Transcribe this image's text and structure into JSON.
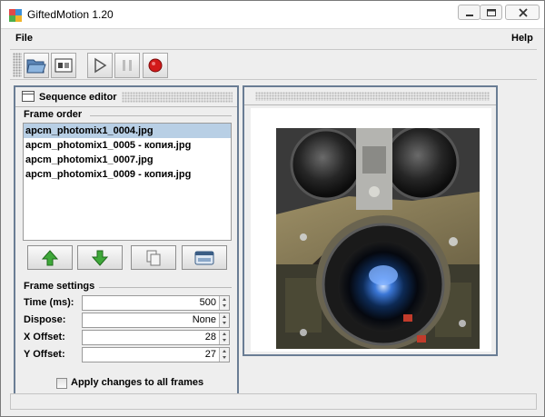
{
  "window": {
    "title": "GiftedMotion 1.20"
  },
  "menu": {
    "file": "File",
    "help": "Help"
  },
  "toolbar": {
    "buttons": [
      "open-icon",
      "frame-settings-icon",
      "play-icon",
      "pause-icon",
      "record-icon"
    ]
  },
  "sequence_editor": {
    "title": "Sequence editor",
    "frame_order_label": "Frame order",
    "frames": [
      "apcm_photomix1_0004.jpg",
      "apcm_photomix1_0005 - копия.jpg",
      "apcm_photomix1_0007.jpg",
      "apcm_photomix1_0009 - копия.jpg"
    ],
    "selected_index": 0,
    "frame_settings_label": "Frame settings",
    "settings": {
      "time_label": "Time (ms):",
      "time_value": "500",
      "dispose_label": "Dispose:",
      "dispose_value": "None",
      "xoffset_label": "X Offset:",
      "xoffset_value": "28",
      "yoffset_label": "Y Offset:",
      "yoffset_value": "27"
    },
    "apply_all_label": "Apply changes to all frames",
    "apply_all_checked": false
  },
  "colors": {
    "panel_border": "#6a7d94",
    "selection": "#b8cfe5",
    "move_arrow": "#3fa83a",
    "record": "#d21a1a"
  }
}
